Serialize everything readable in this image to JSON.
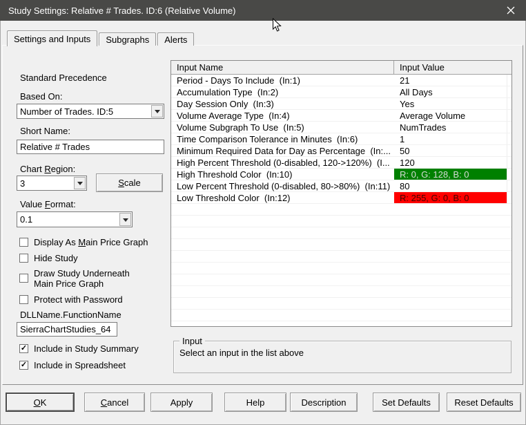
{
  "window": {
    "title": "Study Settings: Relative # Trades. ID:6 (Relative Volume)"
  },
  "tabs": [
    {
      "label": "Settings and Inputs",
      "active": true
    },
    {
      "label": "Subgraphs",
      "active": false
    },
    {
      "label": "Alerts",
      "active": false
    }
  ],
  "left_panel": {
    "precedence_label": "Standard Precedence",
    "based_on_label": "Based On:",
    "based_on_value": "Number of Trades. ID:5",
    "short_name_label": "Short Name:",
    "short_name_value": "Relative # Trades",
    "chart_region_label": {
      "text": "Chart Region:",
      "u": 6
    },
    "chart_region_value": "3",
    "scale_button": {
      "text": "Scale",
      "u": 0
    },
    "value_format_label": {
      "text": "Value Format:",
      "u": 6
    },
    "value_format_value": "0.1",
    "checkboxes": [
      {
        "label": {
          "text": "Display As Main Price Graph",
          "u": 11
        },
        "checked": false
      },
      {
        "label": "Hide Study",
        "checked": false
      },
      {
        "label": "Draw Study Underneath Main Price Graph",
        "checked": false
      },
      {
        "label": "Protect with Password",
        "checked": false
      }
    ],
    "dll_label": "DLLName.FunctionName",
    "dll_value": "SierraChartStudies_64",
    "summary_checkboxes": [
      {
        "label": "Include in Study Summary",
        "checked": true
      },
      {
        "label": "Include in Spreadsheet",
        "checked": true
      }
    ]
  },
  "inputs_table": {
    "columns": [
      "Input Name",
      "Input Value"
    ],
    "rows": [
      {
        "name": "Period - Days To Include  (In:1)",
        "value": "21"
      },
      {
        "name": "Accumulation Type  (In:2)",
        "value": "All Days"
      },
      {
        "name": "Day Session Only  (In:3)",
        "value": "Yes"
      },
      {
        "name": "Volume Average Type  (In:4)",
        "value": "Average Volume"
      },
      {
        "name": "Volume Subgraph To Use  (In:5)",
        "value": "NumTrades"
      },
      {
        "name": "Time Comparison Tolerance in Minutes  (In:6)",
        "value": "1"
      },
      {
        "name": "Minimum Required Data for Day as Percentage  (In:...",
        "value": "50"
      },
      {
        "name": "High Percent Threshold (0-disabled, 120->120%)  (I...",
        "value": "120"
      },
      {
        "name": "High Threshold Color  (In:10)",
        "value": "R: 0, G: 128, B: 0",
        "value_bg": "#008000",
        "value_fg": "#d7dbd7"
      },
      {
        "name": "Low Percent Threshold (0-disabled, 80->80%)  (In:11)",
        "value": "80"
      },
      {
        "name": "Low Threshold Color  (In:12)",
        "value": "R: 255, G: 0, B: 0",
        "value_bg": "#ff0000",
        "value_fg": "#400400"
      }
    ]
  },
  "input_group": {
    "legend": "Input",
    "message": "Select an input in the list above"
  },
  "buttons": [
    {
      "label": {
        "text": "OK",
        "u": 0
      },
      "default": true
    },
    {
      "label": {
        "text": "Cancel",
        "u": 0
      }
    },
    {
      "label": "Apply"
    },
    {
      "label": "Help"
    },
    {
      "label": "Description"
    },
    {
      "label": "Set Defaults"
    },
    {
      "label": "Reset Defaults"
    }
  ],
  "colors": {
    "titlebar": "#494947",
    "high_threshold": "#008000",
    "low_threshold": "#ff0000"
  }
}
